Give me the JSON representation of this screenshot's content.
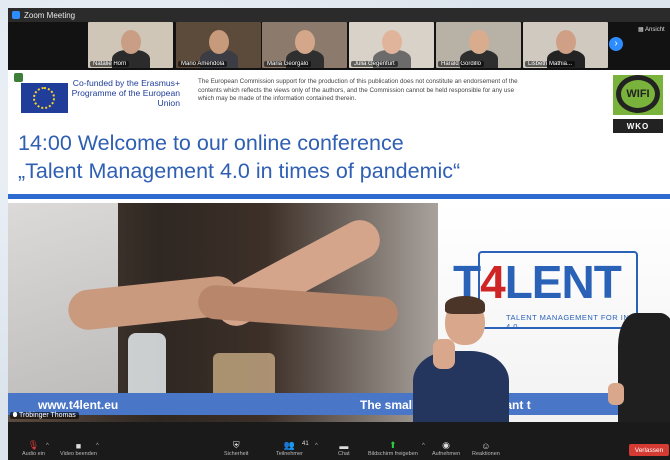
{
  "window": {
    "title": "Zoom Meeting"
  },
  "strip": {
    "view_label": "Ansicht",
    "next_label": "›",
    "participants": [
      {
        "name": "Natalie Horn",
        "bg": "#cfc6b8",
        "skin": "#c99e84",
        "shirt": "#2b2b2b"
      },
      {
        "name": "Mario Amendola",
        "bg": "#5c4a3b",
        "skin": "#c89a7c",
        "shirt": "#3c3c44"
      },
      {
        "name": "Maria Georgalo",
        "bg": "#8c7b6d",
        "skin": "#d4a78a",
        "shirt": "#2f2f2f"
      },
      {
        "name": "Julia Gegenfurt",
        "bg": "#d8d2c8",
        "skin": "#e0b49a",
        "shirt": "#6b6b6b"
      },
      {
        "name": "Harald Gordillo",
        "bg": "#b8b2a6",
        "skin": "#d9ac8e",
        "shirt": "#2e2e2e"
      },
      {
        "name": "Lisbeth Mathia...",
        "bg": "#cfc9bf",
        "skin": "#cfa085",
        "shirt": "#232323"
      }
    ]
  },
  "slide": {
    "cofund_text": "Co-funded by the Erasmus+ Programme of the European Union",
    "disclaimer": "The European Commission support for the production of this publication does not constitute an endorsement of the contents which reflects the views only of the authors, and the Commission cannot be held responsible for any use which may be made of the information contained therein.",
    "wifi_text": "WIFI",
    "wko_text": "WKO",
    "heading_line1": "14:00 Welcome to our online conference",
    "heading_line2": "„Talent Management 4.0 in times of pandemic“",
    "brand_t": "T",
    "brand_4": "4",
    "brand_lent": "LENT",
    "brand_sub": "TALENT MANAGEMENT FOR INDUSTRY 4.0",
    "site_url": "www.t4lent.eu",
    "tagline": "The smalle            e more important t"
  },
  "active_speaker": {
    "name": "Tröbinger Thomas"
  },
  "toolbar": {
    "audio": {
      "label": "Audio ein",
      "icon": "microphone-muted-icon"
    },
    "video": {
      "label": "Video beenden",
      "icon": "video-camera-icon"
    },
    "security": {
      "label": "Sicherheit",
      "icon": "shield-icon"
    },
    "participants": {
      "label": "Teilnehmer",
      "count": "41",
      "icon": "participants-icon"
    },
    "chat": {
      "label": "Chat",
      "icon": "chat-bubble-icon"
    },
    "share": {
      "label": "Bildschirm freigeben",
      "icon": "share-screen-icon"
    },
    "record": {
      "label": "Aufnehmen",
      "icon": "record-icon"
    },
    "reactions": {
      "label": "Reaktionen",
      "icon": "emoji-icon"
    },
    "leave": {
      "label": "Verlassen"
    }
  },
  "colors": {
    "accent_blue": "#2d6bd1",
    "heading_blue": "#2f5fb3",
    "leave_red": "#d63b33",
    "share_green": "#2ecc40"
  }
}
